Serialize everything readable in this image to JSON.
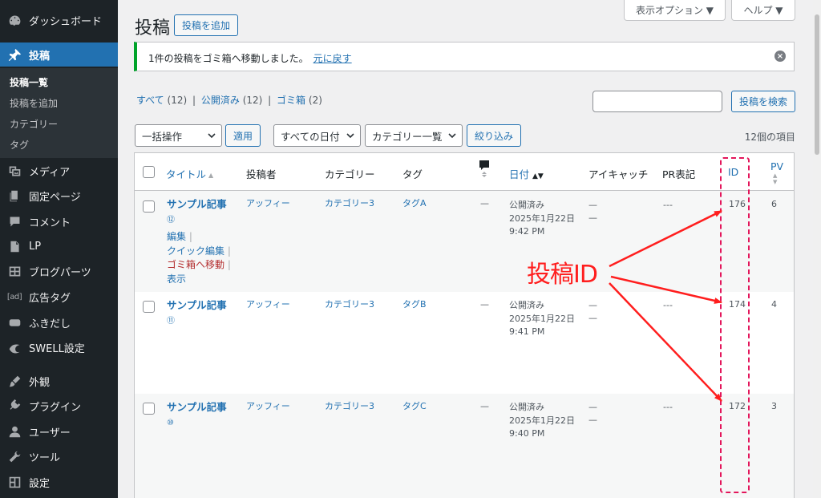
{
  "sidebar": {
    "dashboard": "ダッシュボード",
    "posts": "投稿",
    "submenu": [
      "投稿一覧",
      "投稿を追加",
      "カテゴリー",
      "タグ"
    ],
    "media": "メディア",
    "pages": "固定ページ",
    "comments": "コメント",
    "lp": "LP",
    "blog_parts": "ブログパーツ",
    "ad_tag_icon": "[ad]",
    "ad_tag": "広告タグ",
    "balloon": "ふきだし",
    "swell": "SWELL設定",
    "appearance": "外観",
    "plugins": "プラグイン",
    "users": "ユーザー",
    "tools": "ツール",
    "settings": "設定"
  },
  "header": {
    "title": "投稿",
    "add_new": "投稿を追加",
    "screen_options": "表示オプション ▼",
    "help": "ヘルプ ▼"
  },
  "notice": {
    "text": "1件の投稿をゴミ箱へ移動しました。",
    "undo": "元に戻す"
  },
  "filters": {
    "all": "すべて",
    "all_count": "(12)",
    "published": "公開済み",
    "published_count": "(12)",
    "trash": "ゴミ箱",
    "trash_count": "(2)",
    "search_button": "投稿を検索",
    "bulk_action": "一括操作",
    "apply": "適用",
    "all_dates": "すべての日付",
    "category_list": "カテゴリー一覧",
    "filter_button": "絞り込み",
    "items_count": "12個の項目"
  },
  "table": {
    "headers": {
      "title": "タイトル",
      "author": "投稿者",
      "category": "カテゴリー",
      "tag": "タグ",
      "date": "日付",
      "eyecatch": "アイキャッチ",
      "pr": "PR表記",
      "id": "ID",
      "pv": "PV"
    },
    "row_actions": {
      "edit": "編集",
      "quick_edit": "クイック編集",
      "trash": "ゴミ箱へ移動",
      "view": "表示"
    },
    "rows": [
      {
        "title": "サンプル記事",
        "num": "⑫",
        "author": "アッフィー",
        "category": "カテゴリー3",
        "tag": "タグA",
        "comments": "—",
        "status": "公開済み",
        "date": "2025年1月22日",
        "time": "9:42 PM",
        "eyecatch1": "—",
        "eyecatch2": "—",
        "pr": "---",
        "id": "176",
        "pv": "6"
      },
      {
        "title": "サンプル記事",
        "num": "⑪",
        "author": "アッフィー",
        "category": "カテゴリー3",
        "tag": "タグB",
        "comments": "—",
        "status": "公開済み",
        "date": "2025年1月22日",
        "time": "9:41 PM",
        "eyecatch1": "—",
        "eyecatch2": "—",
        "pr": "---",
        "id": "174",
        "pv": "4"
      },
      {
        "title": "サンプル記事",
        "num": "⑩",
        "author": "アッフィー",
        "category": "カテゴリー3",
        "tag": "タグC",
        "comments": "—",
        "status": "公開済み",
        "date": "2025年1月22日",
        "time": "9:40 PM",
        "eyecatch1": "—",
        "eyecatch2": "—",
        "pr": "---",
        "id": "172",
        "pv": "3"
      }
    ]
  },
  "annotation": {
    "label": "投稿ID",
    "color": "#ff1e1e",
    "box_color": "#e3165b"
  },
  "colors": {
    "accent": "#2271b1",
    "sidebar_bg": "#1d2327",
    "notice_success": "#00a32a",
    "trash": "#b32d2e"
  }
}
